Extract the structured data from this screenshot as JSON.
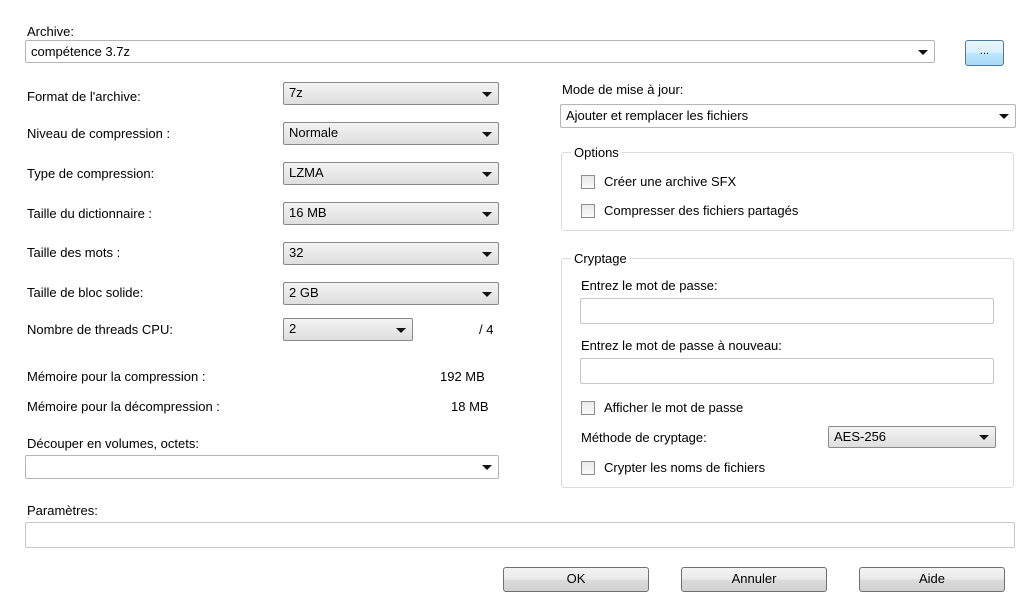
{
  "archive": {
    "label": "Archive:",
    "value": "compétence 3.7z",
    "browse_label": "..."
  },
  "left": {
    "format": {
      "label": "Format de l'archive:",
      "value": "7z"
    },
    "level": {
      "label": "Niveau de compression :",
      "value": "Normale"
    },
    "type": {
      "label": "Type de compression:",
      "value": "LZMA"
    },
    "dict": {
      "label": "Taille du dictionnaire :",
      "value": "16 MB"
    },
    "word": {
      "label": "Taille des mots :",
      "value": "32"
    },
    "solid": {
      "label": "Taille de bloc solide:",
      "value": "2 GB"
    },
    "threads": {
      "label": "Nombre de threads CPU:",
      "value": "2",
      "max": "/ 4"
    },
    "mem_comp": {
      "label": "Mémoire pour la compression :",
      "value": "192 MB"
    },
    "mem_decomp": {
      "label": "Mémoire pour la décompression :",
      "value": "18 MB"
    },
    "split": {
      "label": "Découper en volumes, octets:",
      "value": ""
    }
  },
  "update": {
    "label": "Mode de mise à jour:",
    "value": "Ajouter et remplacer les fichiers"
  },
  "options": {
    "title": "Options",
    "sfx_label": "Créer une archive SFX",
    "shared_label": "Compresser des fichiers partagés"
  },
  "crypto": {
    "title": "Cryptage",
    "password_label": "Entrez le mot de passe:",
    "password_again_label": "Entrez le mot de passe à nouveau:",
    "show_password_label": "Afficher le mot de passe",
    "method_label": "Méthode de cryptage:",
    "method_value": "AES-256",
    "encrypt_names_label": "Crypter les noms de fichiers"
  },
  "params": {
    "label": "Paramètres:",
    "value": ""
  },
  "buttons": {
    "ok": "OK",
    "cancel": "Annuler",
    "help": "Aide"
  }
}
